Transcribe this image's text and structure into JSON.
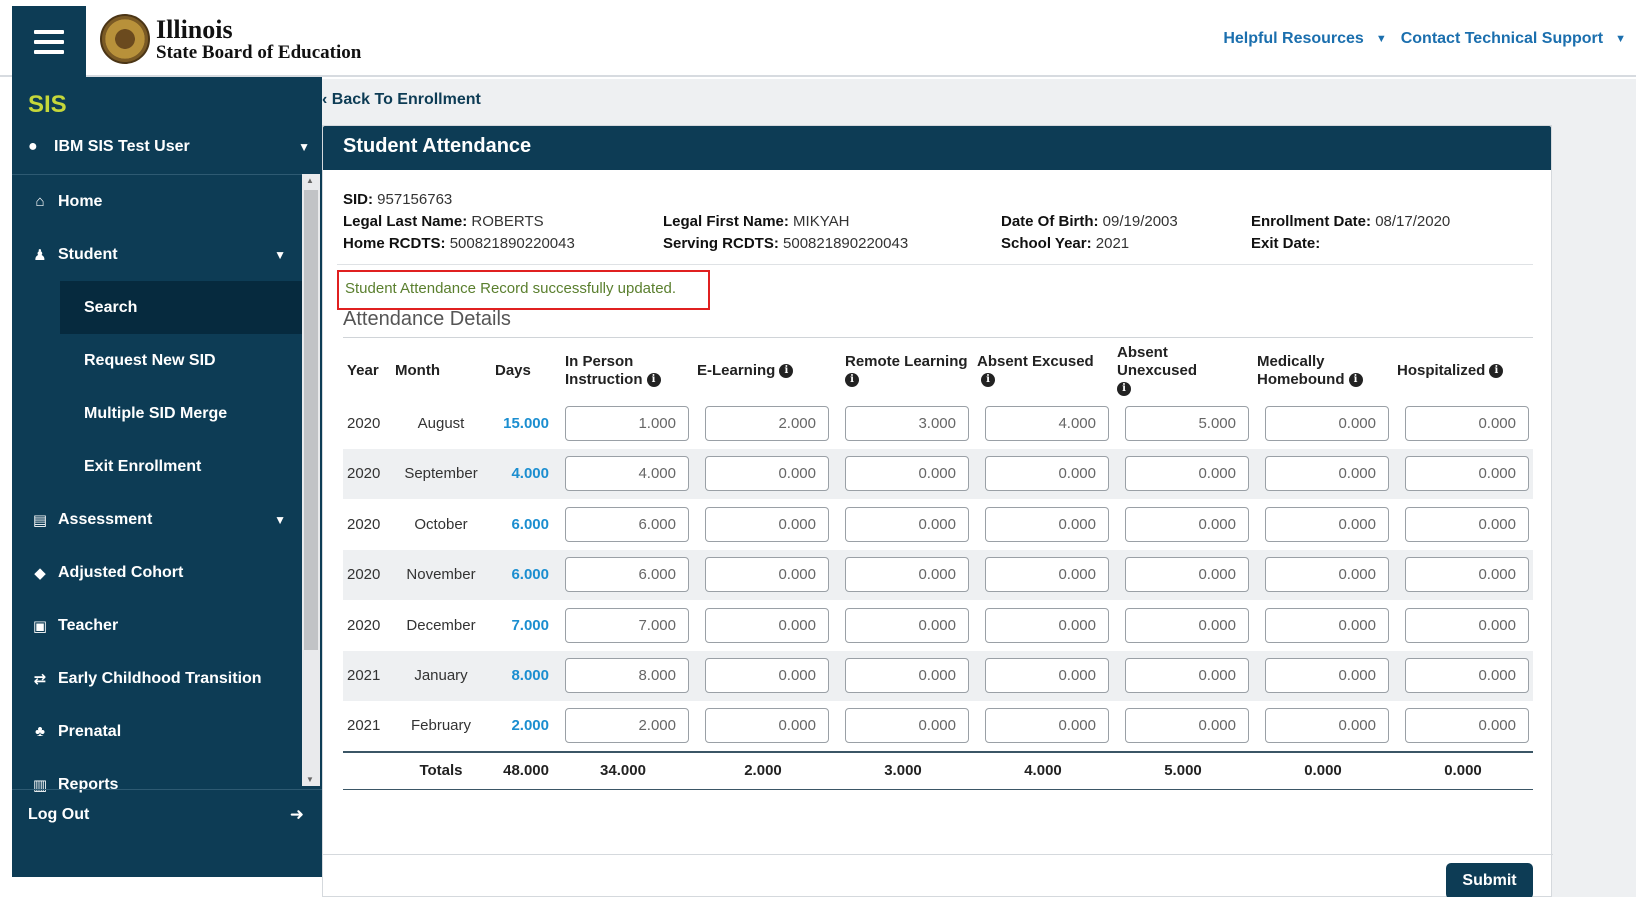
{
  "header": {
    "logo_line1": "Illinois",
    "logo_line2": "State Board of Education",
    "links": [
      "Helpful Resources",
      "Contact Technical Support"
    ]
  },
  "sidebar": {
    "app": "SIS",
    "user": "IBM SIS Test User",
    "items": [
      {
        "label": "Home",
        "icon": "home-icon"
      },
      {
        "label": "Student",
        "icon": "student-icon"
      },
      {
        "label": "Search"
      },
      {
        "label": "Request New SID"
      },
      {
        "label": "Multiple SID Merge"
      },
      {
        "label": "Exit Enrollment"
      },
      {
        "label": "Assessment",
        "icon": "file-icon"
      },
      {
        "label": "Adjusted Cohort",
        "icon": "graduation-cap-icon"
      },
      {
        "label": "Teacher",
        "icon": "chalkboard-icon"
      },
      {
        "label": "Early Childhood Transition",
        "icon": "exchange-icon"
      },
      {
        "label": "Prenatal",
        "icon": "baby-carriage-icon"
      },
      {
        "label": "Reports",
        "icon": "chart-icon"
      }
    ],
    "logout": "Log Out"
  },
  "main": {
    "back": "Back To Enrollment",
    "title": "Student Attendance",
    "student": {
      "sid_label": "SID:",
      "sid": "957156763",
      "last_label": "Legal Last Name:",
      "last": "ROBERTS",
      "first_label": "Legal First Name:",
      "first": "MIKYAH",
      "dob_label": "Date Of Birth:",
      "dob": "09/19/2003",
      "enroll_label": "Enrollment Date:",
      "enroll": "08/17/2020",
      "home_label": "Home RCDTS:",
      "home": "500821890220043",
      "serving_label": "Serving RCDTS:",
      "serving": "500821890220043",
      "year_label": "School Year:",
      "year": "2021",
      "exit_label": "Exit Date:",
      "exit": ""
    },
    "success": "Student Attendance Record successfully updated.",
    "section": "Attendance Details",
    "columns": [
      "Year",
      "Month",
      "Days",
      "In Person Instruction",
      "E-Learning",
      "Remote Learning",
      "Absent Excused",
      "Absent Unexcused",
      "Medically Homebound",
      "Hospitalized"
    ],
    "rows": [
      {
        "year": "2020",
        "month": "August",
        "days": "15.000",
        "v": [
          "1.000",
          "2.000",
          "3.000",
          "4.000",
          "5.000",
          "0.000",
          "0.000"
        ]
      },
      {
        "year": "2020",
        "month": "September",
        "days": "4.000",
        "v": [
          "4.000",
          "0.000",
          "0.000",
          "0.000",
          "0.000",
          "0.000",
          "0.000"
        ]
      },
      {
        "year": "2020",
        "month": "October",
        "days": "6.000",
        "v": [
          "6.000",
          "0.000",
          "0.000",
          "0.000",
          "0.000",
          "0.000",
          "0.000"
        ]
      },
      {
        "year": "2020",
        "month": "November",
        "days": "6.000",
        "v": [
          "6.000",
          "0.000",
          "0.000",
          "0.000",
          "0.000",
          "0.000",
          "0.000"
        ]
      },
      {
        "year": "2020",
        "month": "December",
        "days": "7.000",
        "v": [
          "7.000",
          "0.000",
          "0.000",
          "0.000",
          "0.000",
          "0.000",
          "0.000"
        ]
      },
      {
        "year": "2021",
        "month": "January",
        "days": "8.000",
        "v": [
          "8.000",
          "0.000",
          "0.000",
          "0.000",
          "0.000",
          "0.000",
          "0.000"
        ]
      },
      {
        "year": "2021",
        "month": "February",
        "days": "2.000",
        "v": [
          "2.000",
          "0.000",
          "0.000",
          "0.000",
          "0.000",
          "0.000",
          "0.000"
        ]
      }
    ],
    "totals": {
      "label": "Totals",
      "days": "48.000",
      "v": [
        "34.000",
        "2.000",
        "3.000",
        "4.000",
        "5.000",
        "0.000",
        "0.000"
      ]
    },
    "submit": "Submit"
  }
}
